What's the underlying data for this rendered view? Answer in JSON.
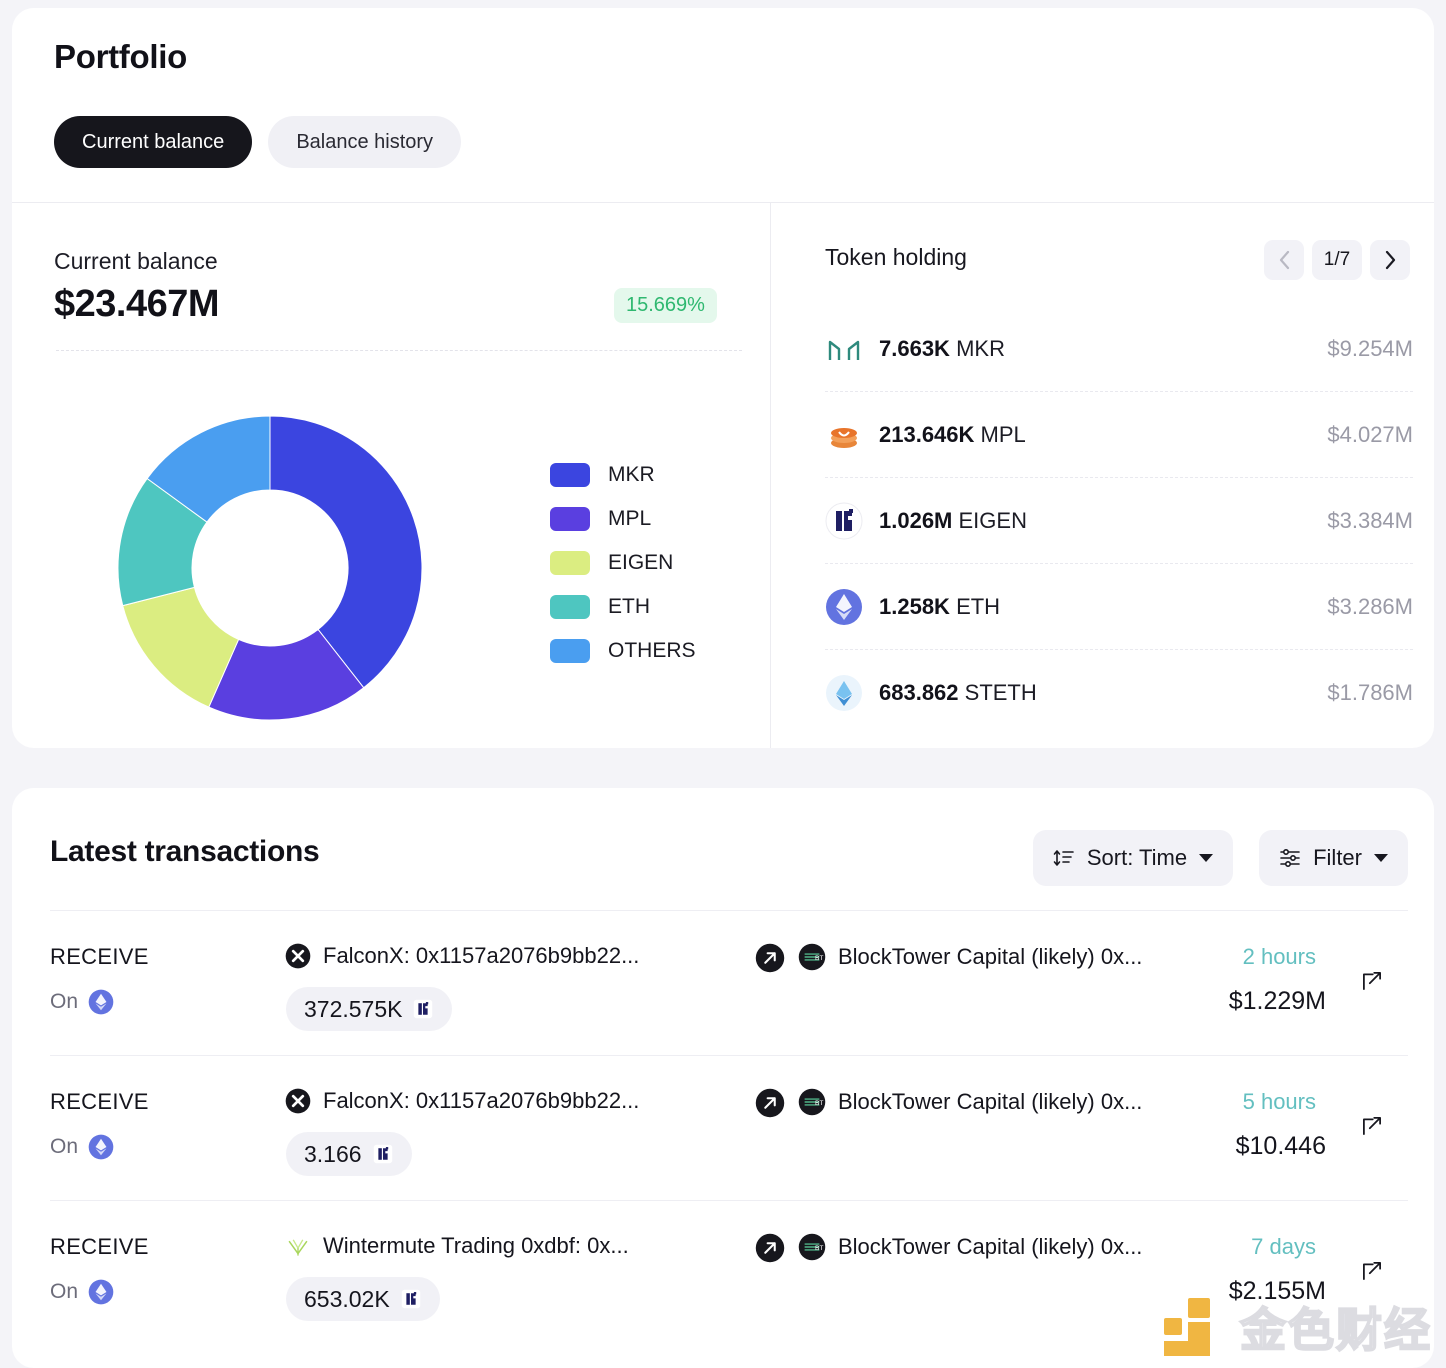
{
  "header": {
    "title": "Portfolio",
    "tabs": [
      {
        "label": "Current balance",
        "active": true
      },
      {
        "label": "Balance history",
        "active": false
      }
    ]
  },
  "balance": {
    "label": "Current balance",
    "value": "$23.467M",
    "change": "15.669%",
    "change_color": "#2fb870"
  },
  "chart_data": {
    "type": "pie",
    "title": "Current balance",
    "legend_position": "right",
    "categories": [
      "MKR",
      "MPL",
      "EIGEN",
      "ETH",
      "OTHERS"
    ],
    "values": [
      9.254,
      4.027,
      3.384,
      3.286,
      3.516
    ],
    "value_unit": "$M",
    "percentages": [
      39.4,
      17.2,
      14.4,
      14.0,
      15.0
    ],
    "colors": [
      "#3b45e0",
      "#5a3fe0",
      "#dbed81",
      "#4ec6c0",
      "#4a9ef0"
    ],
    "total": "$23.467M"
  },
  "token_holding": {
    "title": "Token holding",
    "page": "1/7",
    "prev_label": "‹",
    "next_label": "›",
    "rows": [
      {
        "icon": "mkr-icon",
        "amount": "7.663K",
        "symbol": "MKR",
        "usd": "$9.254M"
      },
      {
        "icon": "mpl-icon",
        "amount": "213.646K",
        "symbol": "MPL",
        "usd": "$4.027M"
      },
      {
        "icon": "eigen-icon",
        "amount": "1.026M",
        "symbol": "EIGEN",
        "usd": "$3.384M"
      },
      {
        "icon": "eth-icon",
        "amount": "1.258K",
        "symbol": "ETH",
        "usd": "$3.286M"
      },
      {
        "icon": "steth-icon",
        "amount": "683.862",
        "symbol": "STETH",
        "usd": "$1.786M"
      }
    ]
  },
  "transactions": {
    "title": "Latest transactions",
    "sort_label": "Sort: Time",
    "filter_label": "Filter",
    "rows": [
      {
        "direction": "RECEIVE",
        "on_label": "On",
        "on_chain_icon": "ethereum-icon",
        "from_icon": "falconx-icon",
        "from": "FalconX: 0x1157a2076b9bb22...",
        "amount": "372.575K",
        "amount_token_icon": "eigen-icon",
        "to_icon": "blocktower-icon",
        "to": "BlockTower Capital (likely) 0x...",
        "time": "2 hours",
        "usd": "$1.229M"
      },
      {
        "direction": "RECEIVE",
        "on_label": "On",
        "on_chain_icon": "ethereum-icon",
        "from_icon": "falconx-icon",
        "from": "FalconX: 0x1157a2076b9bb22...",
        "amount": "3.166",
        "amount_token_icon": "eigen-icon",
        "to_icon": "blocktower-icon",
        "to": "BlockTower Capital (likely) 0x...",
        "time": "5 hours",
        "usd": "$10.446"
      },
      {
        "direction": "RECEIVE",
        "on_label": "On",
        "on_chain_icon": "ethereum-icon",
        "from_icon": "wintermute-icon",
        "from": "Wintermute Trading 0xdbf: 0x...",
        "amount": "653.02K",
        "amount_token_icon": "eigen-icon",
        "to_icon": "blocktower-icon",
        "to": "BlockTower Capital (likely) 0x...",
        "time": "7 days",
        "usd": "$2.155M"
      }
    ]
  },
  "watermark": {
    "text": "金色财经",
    "color": "#eeac28"
  }
}
